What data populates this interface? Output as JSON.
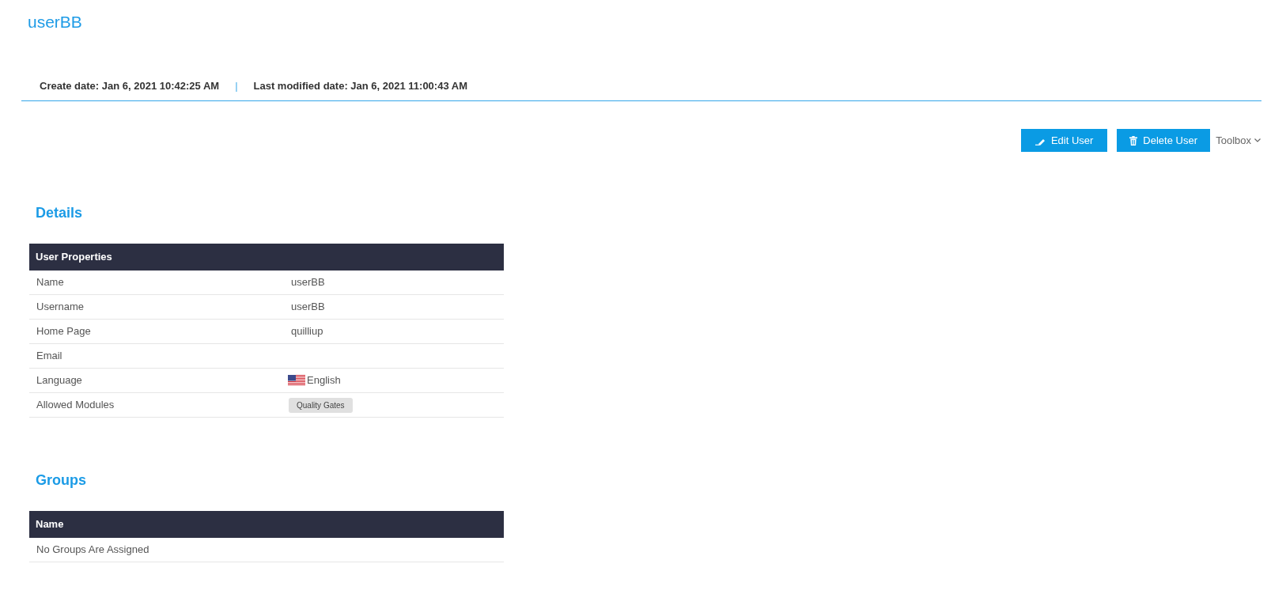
{
  "page": {
    "title": "userBB"
  },
  "meta": {
    "created": "Create date: Jan 6, 2021 10:42:25 AM",
    "separator": "|",
    "modified": "Last modified date: Jan 6, 2021 11:00:43 AM"
  },
  "actions": [
    {
      "kind": "edit",
      "label": "Edit User"
    },
    {
      "kind": "delete",
      "label": "Delete User"
    },
    {
      "kind": "dropdown",
      "label": "Toolbox"
    }
  ],
  "details": {
    "heading": "Details",
    "table": {
      "columns": [
        "User Properties"
      ],
      "rows": [
        {
          "kind": "text",
          "label": "Name",
          "value": "userBB"
        },
        {
          "kind": "text",
          "label": "Username",
          "value": "userBB"
        },
        {
          "kind": "text",
          "label": "Home Page",
          "value": "quilliup"
        },
        {
          "kind": "text",
          "label": "Email"
        },
        {
          "kind": "language",
          "label": "Language",
          "value": "English"
        },
        {
          "kind": "tags",
          "label": "Allowed Modules",
          "tags": [
            "Quality Gates"
          ]
        }
      ]
    }
  },
  "groups": {
    "heading": "Groups",
    "table": {
      "columns": [
        "Name"
      ],
      "empty_message": "No Groups Are Assigned"
    }
  }
}
